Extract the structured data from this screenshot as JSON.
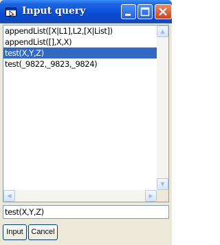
{
  "window": {
    "title": "Input query",
    "app_icon": "query-window-icon"
  },
  "titlebar_buttons": [
    {
      "name": "minimize-button",
      "icon": "minimize-icon"
    },
    {
      "name": "maximize-button",
      "icon": "maximize-icon"
    },
    {
      "name": "close-button",
      "icon": "close-icon"
    }
  ],
  "query_list": {
    "items": [
      "appendList([X|L1],L2,[X|List])",
      "appendList([],X,X)",
      "test(X,Y,Z)",
      "test(_9822,_9823,_9824)"
    ],
    "selected_index": 2
  },
  "query_input": {
    "value": "test(X,Y,Z)"
  },
  "buttons": {
    "input_label": "Input",
    "cancel_label": "Cancel"
  },
  "colors": {
    "titlebar": "#0a4fd8",
    "selection": "#316ac5",
    "close_button": "#c8461f"
  }
}
